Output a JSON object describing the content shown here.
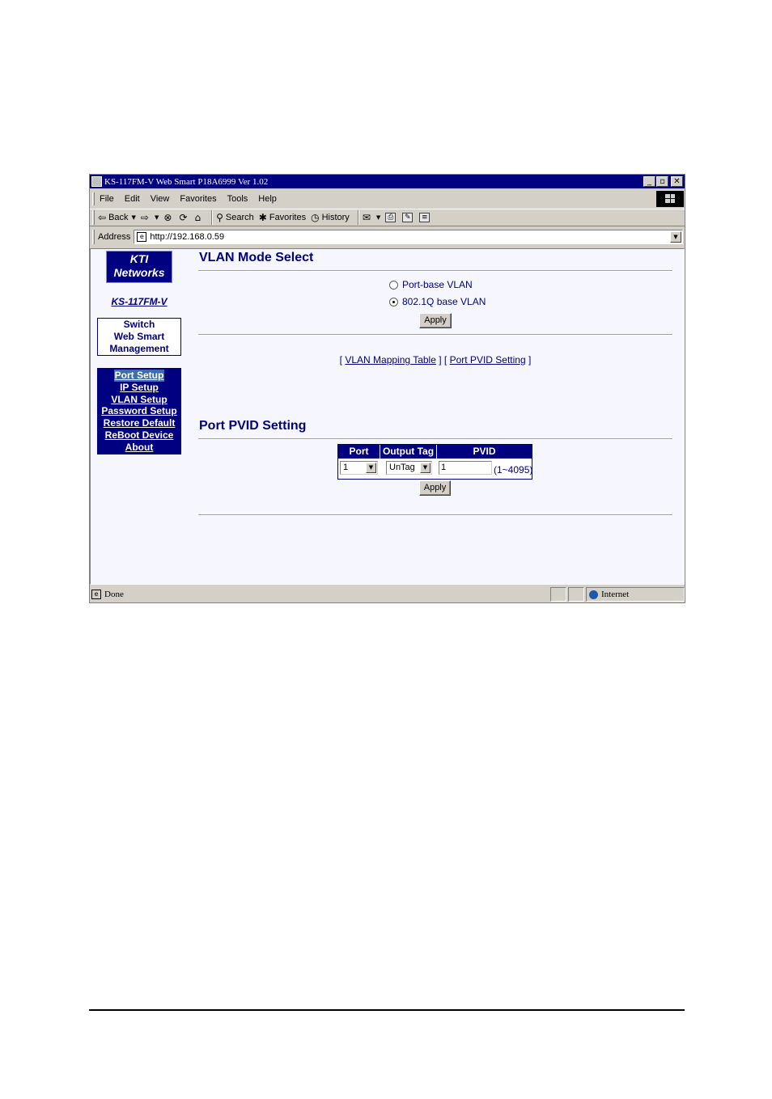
{
  "window": {
    "title": "KS-117FM-V Web Smart P18A6999 Ver 1.02",
    "controls": {
      "minimize": "_",
      "restore": "▫",
      "close": "✕"
    }
  },
  "menubar": {
    "items": [
      "File",
      "Edit",
      "View",
      "Favorites",
      "Tools",
      "Help"
    ]
  },
  "toolbar": {
    "back": "Back",
    "search": "Search",
    "favorites": "Favorites",
    "history": "History"
  },
  "addressbar": {
    "label": "Address",
    "url": "http://192.168.0.59"
  },
  "sidebar": {
    "logo_line1": "KTI",
    "logo_line2": "Networks",
    "model": "KS-117FM-V",
    "mgmt_line1": "Switch",
    "mgmt_line2": "Web Smart",
    "mgmt_line3": "Management",
    "nav": [
      "Port Setup",
      "IP Setup",
      "VLAN Setup",
      "Password Setup",
      "Restore Default",
      "ReBoot Device",
      "About"
    ]
  },
  "vlan_mode": {
    "title": "VLAN Mode Select",
    "option_port": "Port-base VLAN",
    "option_8021q": "802.1Q base VLAN",
    "selected": "802.1Q base VLAN",
    "apply": "Apply"
  },
  "links": {
    "open1": "[",
    "vlan_table": "VLAN Mapping Table",
    "sep": "] [",
    "pvid_setting": "Port PVID Setting",
    "close": "]"
  },
  "pvid": {
    "title": "Port PVID Setting",
    "col_port": "Port",
    "col_tag": "Output Tag",
    "col_pvid": "PVID",
    "port_value": "1",
    "tag_value": "UnTag",
    "pvid_value": "1",
    "range": "(1~4095)",
    "apply": "Apply"
  },
  "status": {
    "text": "Done",
    "zone": "Internet"
  },
  "colors": {
    "navy": "#000080",
    "page_bg": "#f6f6ff",
    "chrome": "#d4d0c8"
  }
}
